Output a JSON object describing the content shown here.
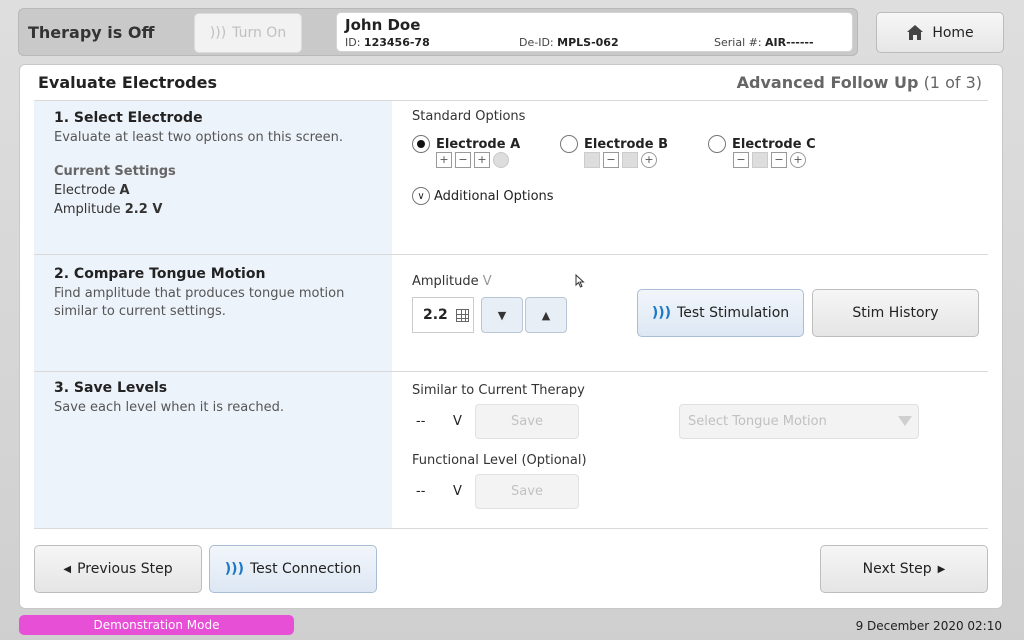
{
  "topbar": {
    "therapy_status": "Therapy is Off",
    "turn_on_label": "Turn On",
    "patient": {
      "name": "John Doe",
      "id_label": "ID:",
      "id_value": "123456-78",
      "deid_label": "De-ID:",
      "deid_value": "MPLS-062",
      "serial_label": "Serial #:",
      "serial_value": "AIR------"
    },
    "home_label": "Home"
  },
  "panel": {
    "title": "Evaluate Electrodes",
    "step_label": "Advanced Follow Up",
    "step_progress": "(1 of 3)"
  },
  "section1": {
    "title": "1. Select Electrode",
    "desc": "Evaluate at least two options on this screen.",
    "current_settings_label": "Current Settings",
    "electrode_label": "Electrode",
    "electrode_value": "A",
    "amplitude_label": "Amplitude",
    "amplitude_value": "2.2 V",
    "standard_options_label": "Standard Options",
    "options": [
      {
        "label": "Electrode A",
        "selected": true,
        "contacts": [
          "+",
          "−",
          "+",
          "•"
        ]
      },
      {
        "label": "Electrode B",
        "selected": false,
        "contacts": [
          "",
          "−",
          "",
          "+"
        ]
      },
      {
        "label": "Electrode C",
        "selected": false,
        "contacts": [
          "−",
          "",
          "−",
          "+"
        ]
      }
    ],
    "additional_options_label": "Additional Options"
  },
  "section2": {
    "title": "2. Compare Tongue Motion",
    "desc": "Find amplitude that produces tongue motion similar to current settings.",
    "amplitude_label": "Amplitude",
    "amplitude_unit": "V",
    "amplitude_value": "2.2",
    "down_label": "▼",
    "up_label": "▲",
    "test_stimulation_label": "Test Stimulation",
    "stim_history_label": "Stim History"
  },
  "section3": {
    "title": "3. Save Levels",
    "desc": "Save each level when it is reached.",
    "similar_label": "Similar to Current Therapy",
    "similar_value": "--",
    "similar_unit": "V",
    "save_label": "Save",
    "select_placeholder": "Select Tongue Motion",
    "functional_label": "Functional Level (Optional)",
    "functional_value": "--",
    "functional_unit": "V",
    "save2_label": "Save"
  },
  "footer": {
    "previous_label": "Previous Step",
    "test_connection_label": "Test Connection",
    "next_label": "Next Step",
    "demo_label": "Demonstration Mode",
    "datetime": "9 December 2020 02:10"
  },
  "colors": {
    "accent_blue": "#1e78c8",
    "demo_pink": "#e64fd6",
    "left_column_bg": "#edf3fa"
  }
}
